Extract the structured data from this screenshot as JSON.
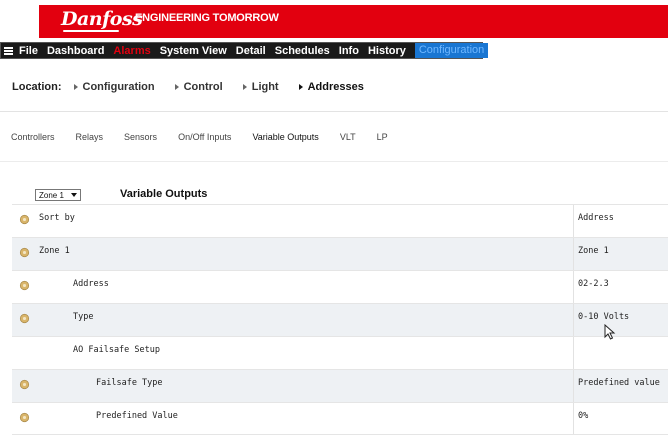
{
  "header": {
    "logo_text": "Danfoss",
    "tagline": "ENGINEERING TOMORROW",
    "brand_color": "#e2000f"
  },
  "menu": {
    "items": [
      {
        "label": "File"
      },
      {
        "label": "Dashboard"
      },
      {
        "label": "Alarms"
      },
      {
        "label": "System View"
      },
      {
        "label": "Detail"
      },
      {
        "label": "Schedules"
      },
      {
        "label": "Info"
      },
      {
        "label": "History"
      },
      {
        "label": "Configuration"
      }
    ],
    "active_color": "#1976d2"
  },
  "breadcrumb": {
    "label": "Location:",
    "items": [
      {
        "label": "Configuration"
      },
      {
        "label": "Control"
      },
      {
        "label": "Light"
      },
      {
        "label": "Addresses"
      }
    ]
  },
  "subtabs": [
    {
      "label": "Controllers"
    },
    {
      "label": "Relays"
    },
    {
      "label": "Sensors"
    },
    {
      "label": "On/Off Inputs"
    },
    {
      "label": "Variable Outputs"
    },
    {
      "label": "VLT"
    },
    {
      "label": "LP"
    }
  ],
  "section": {
    "zone_select_value": "Zone 1",
    "title": "Variable Outputs"
  },
  "rows": [
    {
      "label": "Sort by",
      "value": "Address"
    },
    {
      "label": "Zone 1",
      "value": "Zone 1"
    },
    {
      "label": "Address",
      "value": "02-2.3"
    },
    {
      "label": "Type",
      "value": "0-10 Volts"
    },
    {
      "label": "AO Failsafe Setup",
      "value": ""
    },
    {
      "label": "Failsafe Type",
      "value": "Predefined value"
    },
    {
      "label": "Predefined Value",
      "value": "0%"
    }
  ]
}
